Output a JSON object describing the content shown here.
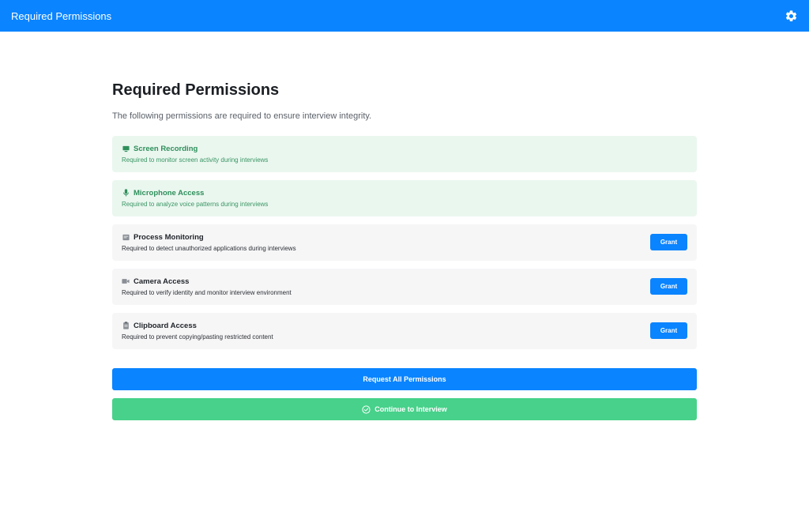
{
  "header": {
    "title": "Required Permissions",
    "settings_icon": "gear-icon",
    "color": "#0a84ff"
  },
  "main": {
    "title": "Required Permissions",
    "description": "The following permissions are required to ensure interview integrity."
  },
  "permissions": [
    {
      "name": "Screen Recording",
      "description": "Required to monitor screen activity during interviews",
      "status": "granted",
      "icon": "monitor-icon"
    },
    {
      "name": "Microphone Access",
      "description": "Required to analyze voice patterns during interviews",
      "status": "granted",
      "icon": "microphone-icon"
    },
    {
      "name": "Process Monitoring",
      "description": "Required to detect unauthorized applications during interviews",
      "status": "pending",
      "icon": "process-icon",
      "button_label": "Grant"
    },
    {
      "name": "Camera Access",
      "description": "Required to verify identity and monitor interview environment",
      "status": "pending",
      "icon": "camera-icon",
      "button_label": "Grant"
    },
    {
      "name": "Clipboard Access",
      "description": "Required to prevent copying/pasting restricted content",
      "status": "pending",
      "icon": "clipboard-icon",
      "button_label": "Grant"
    }
  ],
  "actions": {
    "request_all_label": "Request All Permissions",
    "continue_label": "Continue to Interview",
    "continue_icon": "check-circle-icon"
  },
  "colors": {
    "primary": "#0a84ff",
    "success": "#47d18a",
    "granted_bg": "#eaf7ef",
    "granted_text": "#2f8f5b",
    "pending_bg": "#f6f6f7"
  }
}
